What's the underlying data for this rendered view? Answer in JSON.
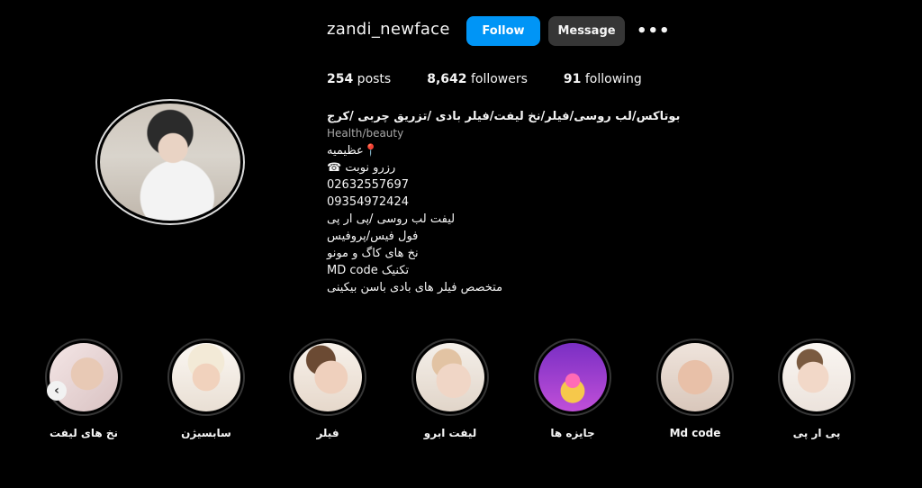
{
  "profile": {
    "username": "zandi_newface",
    "follow_label": "Follow",
    "message_label": "Message",
    "more_label": "•••"
  },
  "stats": {
    "posts_count": "254",
    "posts_label": " posts",
    "followers_count": "8,642",
    "followers_label": " followers",
    "following_count": "91",
    "following_label": " following"
  },
  "bio": {
    "title": "بوتاکس/لب روسی/فیلر/نخ لیفت/فیلر بادی /تزریق چربی /کرج",
    "category": "Health/beauty",
    "lines": [
      "📍عظیمیه",
      "رزرو نوبت ☎",
      "02632557697",
      "09354972424",
      "لیفت لب روسی /پی ار پی",
      "فول فیس/پروفیس",
      "نخ های کاگ و مونو",
      "MD code تکنیک",
      "متخصص فیلر های بادی باسن بیکینی"
    ]
  },
  "highlights": [
    {
      "label": "نخ های لیفت"
    },
    {
      "label": "سابسیژن"
    },
    {
      "label": "فیلر"
    },
    {
      "label": "لیفت ابرو"
    },
    {
      "label": "جایزه ها"
    },
    {
      "label": "Md code"
    },
    {
      "label": "پی ار پی"
    }
  ],
  "icons": {
    "prev_arrow": "‹"
  }
}
